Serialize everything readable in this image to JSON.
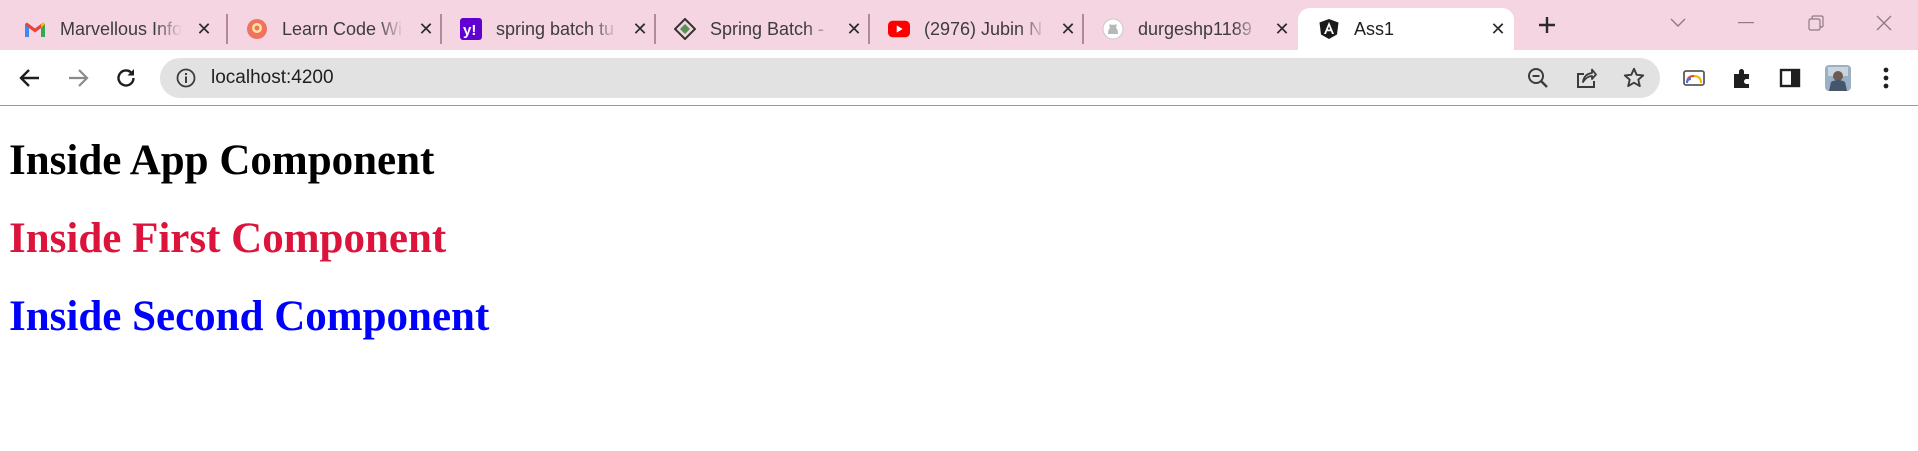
{
  "browser": {
    "tabs": [
      {
        "title": "Marvellous Info",
        "icon": "gmail-icon"
      },
      {
        "title": "Learn Code Wi",
        "icon": "learn-code-icon"
      },
      {
        "title": "spring batch tu",
        "icon": "yahoo-icon"
      },
      {
        "title": "Spring Batch -",
        "icon": "spring-batch-icon"
      },
      {
        "title": "(2976) Jubin N",
        "icon": "youtube-icon"
      },
      {
        "title": "durgeshp1189",
        "icon": "github-icon"
      },
      {
        "title": "Ass1",
        "icon": "angular-icon"
      }
    ],
    "active_tab": 6,
    "address": "localhost:4200"
  },
  "page": {
    "app_heading": "Inside App Component",
    "first_heading": "Inside First Component",
    "second_heading": "Inside Second Component"
  },
  "colors": {
    "tabstrip": "#f5d5e1",
    "app_heading": "#000000",
    "first_heading": "#dc143c",
    "second_heading": "#0000ff"
  }
}
